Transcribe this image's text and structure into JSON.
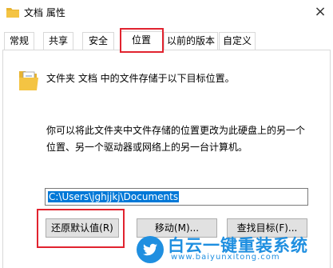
{
  "window": {
    "title": "文档 属性",
    "close_glyph": "×"
  },
  "tabs": [
    {
      "label": "常规",
      "active": false
    },
    {
      "label": "共享",
      "active": false
    },
    {
      "label": "安全",
      "active": false
    },
    {
      "label": "位置",
      "active": true
    },
    {
      "label": "以前的版本",
      "active": false
    },
    {
      "label": "自定义",
      "active": false
    }
  ],
  "location": {
    "folder_icon": "folder-document-icon",
    "description": "文件夹 文档 中的文件存储于以下目标位置。",
    "info_line1": "你可以将此文件夹中文件存储的位置更改为此硬盘上的另一个",
    "info_line2": "位置、另一个驱动器或网络上的另一台计算机。",
    "path_value": "C:\\Users\\jghjjkj\\Documents"
  },
  "buttons": {
    "restore_default": "还原默认值(R)",
    "move": "移动(M)...",
    "find_target": "查找目标(F)..."
  },
  "watermark": {
    "title": "白云一键重装系统",
    "url": "www.baiyunxitong.com"
  },
  "colors": {
    "highlight_red": "#e1232f",
    "selection_blue": "#0078d7",
    "watermark_blue": "#1f8fe0",
    "folder_yellow": "#f4c443"
  }
}
